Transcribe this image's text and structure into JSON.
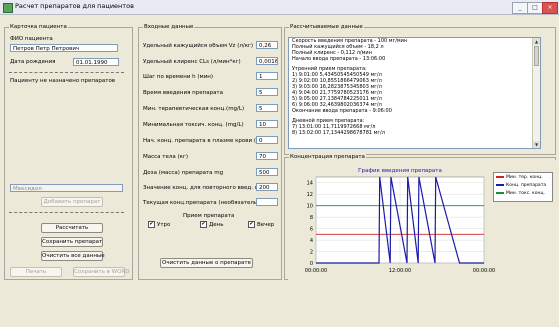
{
  "window": {
    "title": "Расчет препаратов для пациентов"
  },
  "patient_card": {
    "title": "Карточка пациента",
    "fio_label": "ФИО пациента",
    "fio_value": "Петров Петр Петрович",
    "dob_label": "Дата рождения",
    "dob_value": "01.01.1990",
    "no_drugs_text": "Пациенту не назначено препаратов",
    "drug_field_value": "Мексидол",
    "add_drug_button": "Добавить препарат",
    "calc_button": "Рассчитать",
    "save_drug_button": "Сохранить препарат",
    "clear_all_button": "Очистить все данные",
    "print_button": "Печать",
    "save_word_button": "Сохранить в WORD"
  },
  "input_data": {
    "title": "Входные данные",
    "fields": [
      {
        "label": "Удельный кажущийся объем Vz (л/кг)",
        "value": "0,26"
      },
      {
        "label": "Удельный клиренс CLs (л/мин*кг)",
        "value": "0,0016"
      },
      {
        "label": "Шаг по времени h (мин)",
        "value": "1"
      },
      {
        "label": "Время введения препарата",
        "value": "5"
      },
      {
        "label": "Мин. терапевтическая конц.(mg/L)",
        "value": "5"
      },
      {
        "label": "Минимальная токсич. конц. (mg/L)",
        "value": "10"
      },
      {
        "label": "Нач. конц. препарата в плазме крови (мг/л)",
        "value": "0"
      },
      {
        "label": "Масса тела (кг)",
        "value": "70"
      },
      {
        "label": "Доза (масса) препарата mg",
        "value": "500"
      },
      {
        "label": "Значение конц. для повторного введ. преп.",
        "value": "200"
      },
      {
        "label": "Текущая конц.препарата (необязательно)",
        "value": ""
      }
    ],
    "intake_title": "Прием препарата",
    "intake": [
      {
        "label": "Утро",
        "checked": true
      },
      {
        "label": "День",
        "checked": true
      },
      {
        "label": "Вечер",
        "checked": true
      }
    ],
    "clear_drug_button": "Очистить данные о препарате"
  },
  "calculated_data": {
    "title": "Рассчитываемые данные",
    "lines": [
      "Скорость введения препарата - 100 мг/мин",
      "Полный кажущийся объем - 18,2 л",
      "Полный клиренс - 0,112 л/мин",
      "Начало ввода препарата - 13:06:00",
      "",
      "Утренний прием препарата:",
      "1) 9:01:00        5,43450545450549 мг/л",
      "2) 9:02:00        10,8551866479063 мг/л",
      "3) 9:03:00        16,2823875345803 мг/л",
      "4) 9:04:00        21,7759780523176 мг/л",
      "5) 9:05:00        27,1384784225011 мг/л",
      "6) 9:06:00        32,4639802036374 мг/л",
      "Окончание ввода препарата - 9:06:00",
      "",
      "Дневной прием препарата:",
      "7) 13:01:00       11,7119972668 мг/л",
      "8) 13:02:00       17,1344298678781 мг/л"
    ]
  },
  "concentration_chart": {
    "group_title": "Концентрация препарата",
    "chart_title": "График введения препарата",
    "legend": {
      "min_ther": "Мин. тер. конц.",
      "conc": "Конц. препарата",
      "min_tox": "Мин. токс. конц."
    },
    "colors": {
      "min_ther": "#cc2222",
      "conc": "#1a1aa8",
      "min_tox": "#1f8a3a"
    }
  },
  "chart_data": {
    "type": "line",
    "title": "График введения препарата",
    "ylim": [
      0,
      15
    ],
    "yticks": [
      0,
      2,
      4,
      6,
      8,
      10,
      12,
      14
    ],
    "xlim_hours": [
      0,
      24
    ],
    "xtick_labels": [
      "00:00:00",
      "12:00:00",
      "00:00:00"
    ],
    "xtick_hours": [
      0,
      12,
      24
    ],
    "grid": true,
    "legend_position": "top-right",
    "series": [
      {
        "name": "Мин. тер. конц.",
        "color": "#cc2222",
        "x_hours": [
          0,
          24
        ],
        "y": [
          5,
          5
        ]
      },
      {
        "name": "Мин. токс. конц.",
        "color": "#1f8a3a",
        "x_hours": [
          0,
          24
        ],
        "y": [
          10,
          10
        ]
      },
      {
        "name": "Конц. препарата",
        "color": "#1a1aa8",
        "x_hours": [
          0,
          9.0,
          9.1,
          10.6,
          10.7,
          13.0,
          13.1,
          14.6,
          14.7,
          17.0,
          17.1,
          20.5,
          24
        ],
        "y": [
          0,
          0,
          15,
          0,
          15,
          0,
          15,
          0,
          15,
          0,
          15,
          0,
          0
        ]
      }
    ]
  }
}
